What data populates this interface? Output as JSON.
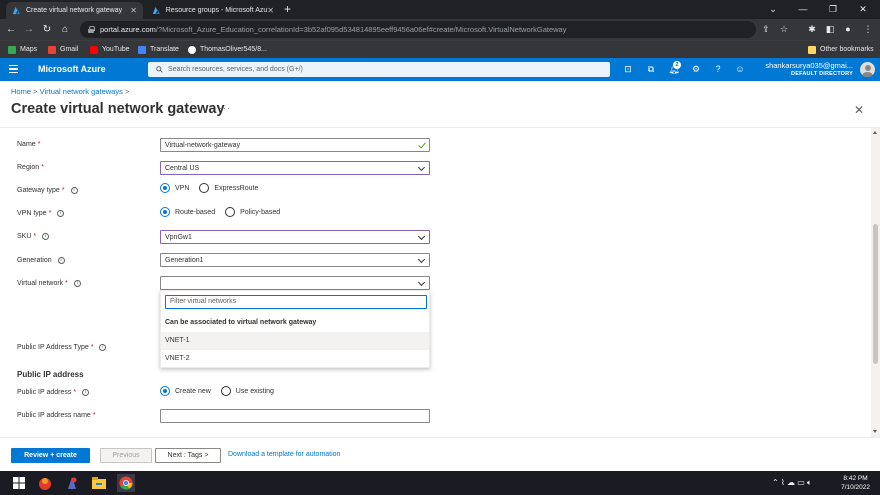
{
  "browser": {
    "tabs": [
      {
        "title": "Create virtual network gateway",
        "active": true
      },
      {
        "title": "Resource groups - Microsoft Azu",
        "active": false
      }
    ],
    "url_host": "portal.azure.com",
    "url_path": "/?Microsoft_Azure_Education_correlationId=3b52af095d534814895eeff9456a06ef#create/Microsoft.VirtualNetworkGateway",
    "bookmarks": [
      "Maps",
      "Gmail",
      "YouTube",
      "Translate",
      "ThomasOliver545/8..."
    ],
    "other_bookmarks": "Other bookmarks"
  },
  "azure_header": {
    "brand": "Microsoft Azure",
    "search_placeholder": "Search resources, services, and docs (G+/)",
    "notification_count": "2",
    "account_email": "shankarsurya035@gmai...",
    "account_directory": "DEFAULT DIRECTORY"
  },
  "breadcrumb": {
    "home": "Home",
    "separator": ">",
    "parent": "Virtual network gateways"
  },
  "page": {
    "title": "Create virtual network gateway",
    "more": "···"
  },
  "form": {
    "name": {
      "label": "Name",
      "value": "Virtual-network-gateway"
    },
    "region": {
      "label": "Region",
      "value": "Central US"
    },
    "gateway_type": {
      "label": "Gateway type",
      "options": [
        "VPN",
        "ExpressRoute"
      ],
      "selected": "VPN"
    },
    "vpn_type": {
      "label": "VPN type",
      "options": [
        "Route-based",
        "Policy-based"
      ],
      "selected": "Route-based"
    },
    "sku": {
      "label": "SKU",
      "value": "VpnGw1"
    },
    "generation": {
      "label": "Generation",
      "value": "Generation1"
    },
    "virtual_network": {
      "label": "Virtual network",
      "value": "",
      "filter_placeholder": "Filter virtual networks",
      "group_header": "Can be associated to virtual network gateway",
      "items": [
        "VNET-1",
        "VNET-2"
      ]
    },
    "public_ip_type": {
      "label": "Public IP Address Type"
    },
    "section_public_ip": "Public IP address",
    "public_ip": {
      "label": "Public IP address",
      "options": [
        "Create new",
        "Use existing"
      ],
      "selected": "Create new"
    },
    "public_ip_name": {
      "label": "Public IP address name",
      "value": ""
    },
    "required_mark": "*",
    "info_glyph": "i"
  },
  "footer": {
    "review_create": "Review + create",
    "previous": "Previous",
    "next": "Next : Tags >",
    "download_link": "Download a template for automation"
  },
  "taskbar": {
    "time": "8:42 PM",
    "date": "7/10/2022"
  },
  "colors": {
    "azure_blue": "#0078d4",
    "chrome_dark": "#202124",
    "chrome_toolbar": "#35363a",
    "required_red": "#a4262c",
    "valid_green": "#57a300",
    "focus_purple": "#8764b8"
  }
}
